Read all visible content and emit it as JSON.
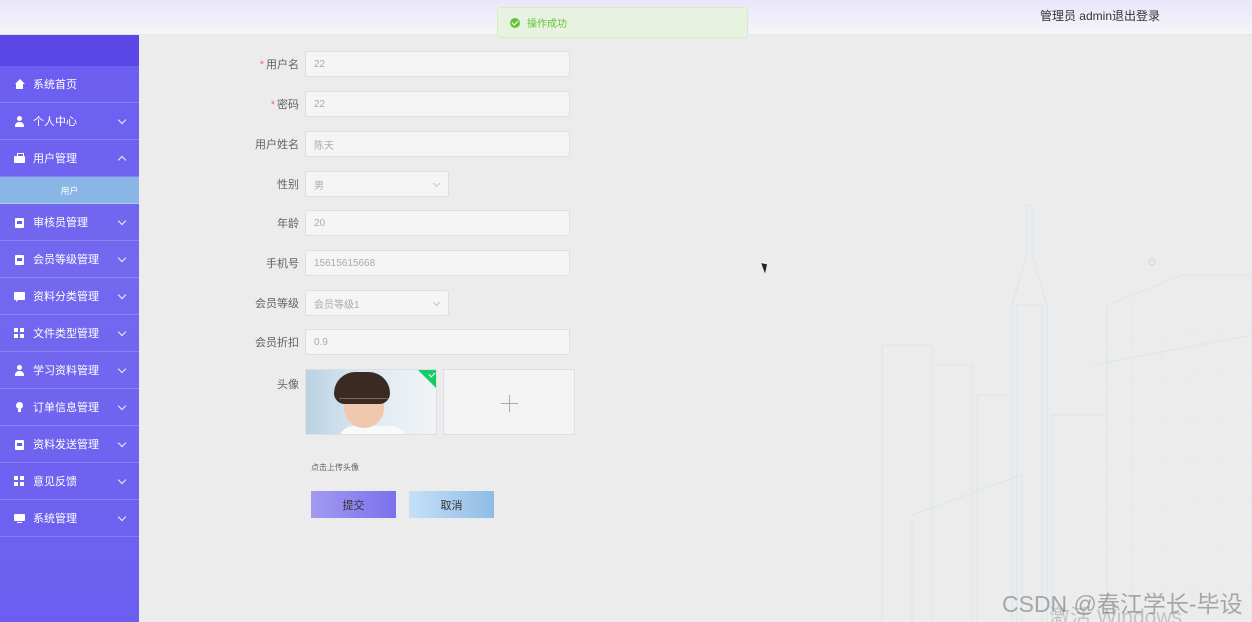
{
  "header": {
    "user_text": "管理员 admin",
    "logout_label": "退出登录"
  },
  "toast": {
    "message": "操作成功",
    "type": "success",
    "color": "#67c23a"
  },
  "sidebar": {
    "accent_color": "#6b5cf0",
    "items": [
      {
        "label": "系统首页",
        "icon": "home-icon",
        "chevron": false
      },
      {
        "label": "个人中心",
        "icon": "user-icon",
        "chevron": true
      },
      {
        "label": "用户管理",
        "icon": "briefcase-icon",
        "chevron": true,
        "expanded": true
      },
      {
        "label": "审核员管理",
        "icon": "clipboard-icon",
        "chevron": true
      },
      {
        "label": "会员等级管理",
        "icon": "clipboard-icon",
        "chevron": true
      },
      {
        "label": "资料分类管理",
        "icon": "chat-icon",
        "chevron": true
      },
      {
        "label": "文件类型管理",
        "icon": "grid-icon",
        "chevron": true
      },
      {
        "label": "学习资料管理",
        "icon": "user-icon",
        "chevron": true
      },
      {
        "label": "订单信息管理",
        "icon": "bulb-icon",
        "chevron": true
      },
      {
        "label": "资料发送管理",
        "icon": "clipboard-icon",
        "chevron": true
      },
      {
        "label": "意见反馈",
        "icon": "grid-icon",
        "chevron": true
      },
      {
        "label": "系统管理",
        "icon": "monitor-icon",
        "chevron": true
      }
    ],
    "subitem_active": "用户"
  },
  "form": {
    "username": {
      "label": "用户名",
      "required": true,
      "value": "22"
    },
    "password": {
      "label": "密码",
      "required": true,
      "value": "22"
    },
    "realname": {
      "label": "用户姓名",
      "required": false,
      "value": "陈天"
    },
    "gender": {
      "label": "性别",
      "required": false,
      "value": "男"
    },
    "age": {
      "label": "年龄",
      "required": false,
      "value": "20"
    },
    "phone": {
      "label": "手机号",
      "required": false,
      "value": "15615615668"
    },
    "level": {
      "label": "会员等级",
      "required": false,
      "value": "会员等级1"
    },
    "discount": {
      "label": "会员折扣",
      "required": false,
      "value": "0.9"
    },
    "avatar": {
      "label": "头像",
      "hint": "点击上传头像"
    },
    "submit_label": "提交",
    "cancel_label": "取消"
  },
  "watermarks": {
    "windows": "激活 Windows",
    "csdn": "CSDN @春江学长-毕设"
  }
}
